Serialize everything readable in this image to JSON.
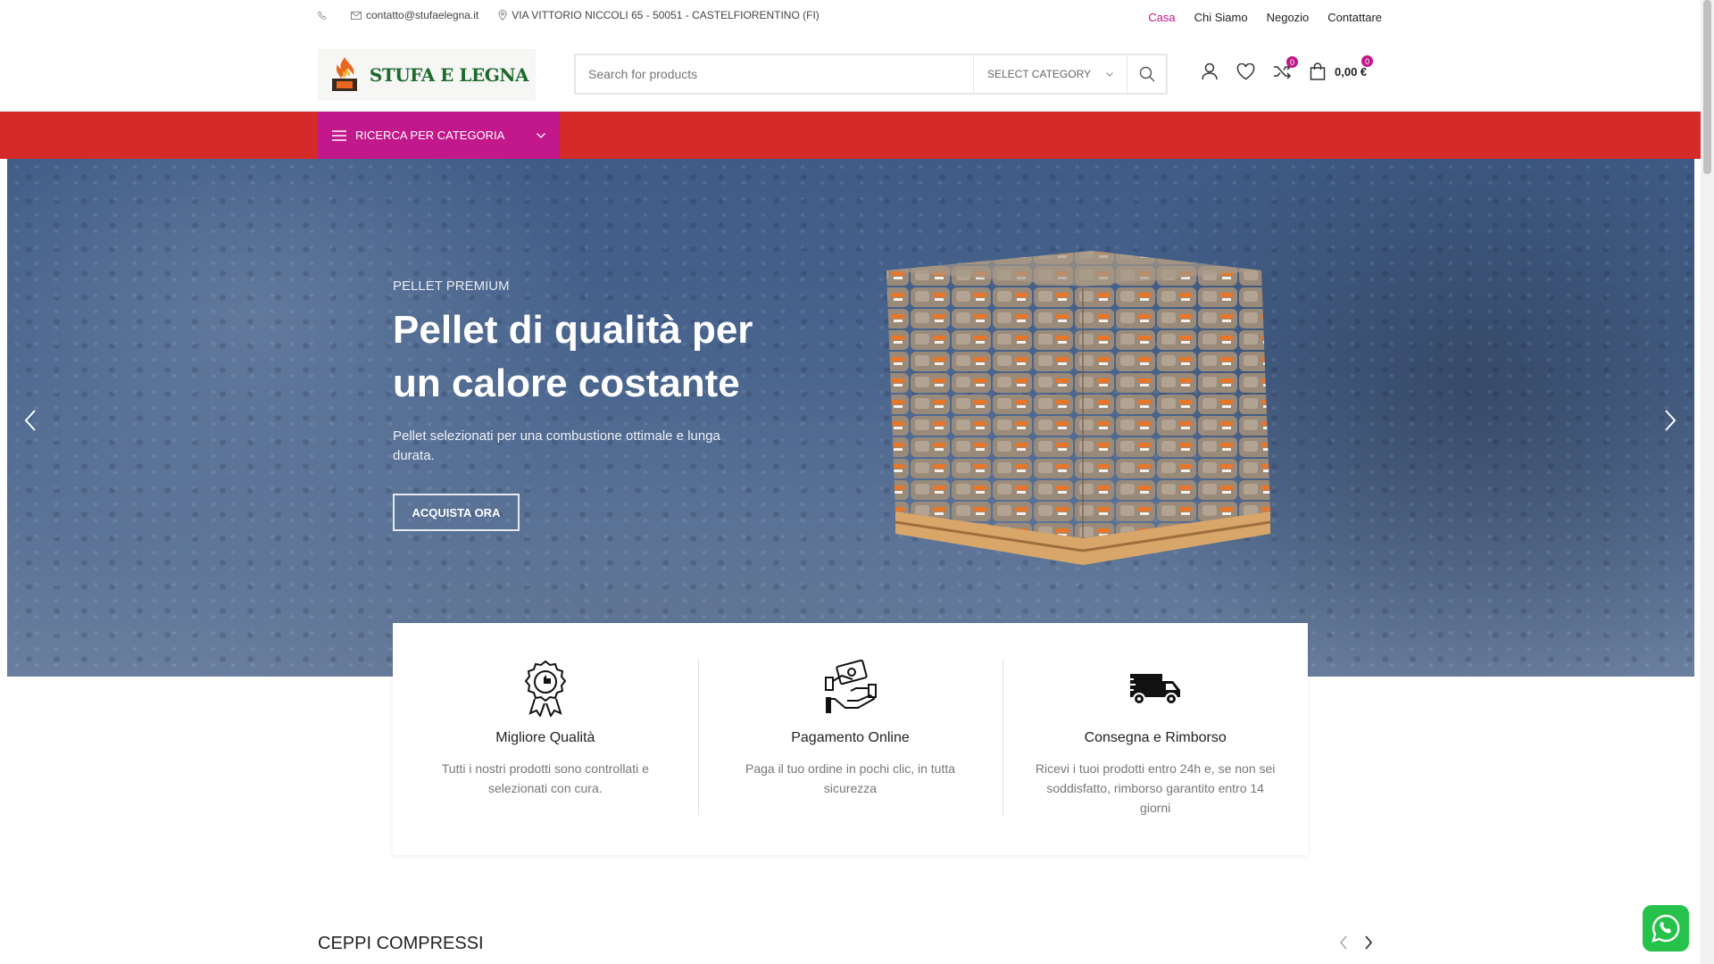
{
  "topbar": {
    "email": "contatto@stufaelegna.it",
    "address": "VIA VITTORIO NICCOLI 65 - 50051 - CASTELFIORENTINO (FI)",
    "nav": [
      "Casa",
      "Chi Siamo",
      "Negozio",
      "Contattare"
    ]
  },
  "header": {
    "logo_text": "STUFA E LEGNA",
    "search_placeholder": "Search for products",
    "category_select": "SELECT CATEGORY",
    "compare_count": "0",
    "cart_count": "0",
    "cart_total": "0,00 €"
  },
  "menu": {
    "category_button": "RICERCA PER CATEGORIA"
  },
  "hero": {
    "subtitle": "PELLET PREMIUM",
    "title": "Pellet di qualità per un calore costante",
    "description": "Pellet selezionati per una combustione ottimale e lunga durata.",
    "cta": "ACQUISTA ORA"
  },
  "features": [
    {
      "title": "Migliore Qualità",
      "text": "Tutti i nostri prodotti sono controllati e selezionati con cura.",
      "icon": "award-ribbon-icon"
    },
    {
      "title": "Pagamento Online",
      "text": "Paga il tuo ordine in pochi clic, in tutta sicurezza",
      "icon": "hand-money-icon"
    },
    {
      "title": "Consegna e Rimborso",
      "text": "Ricevi i tuoi prodotti entro 24h e, se non sei soddisfatto, rimborso garantito entro 14 giorni",
      "icon": "delivery-truck-icon"
    }
  ],
  "section": {
    "title": "CEPPI COMPRESSI"
  },
  "colors": {
    "accent": "#c2188b",
    "menu_bar": "#d42a2a",
    "whatsapp": "#27c24c"
  }
}
